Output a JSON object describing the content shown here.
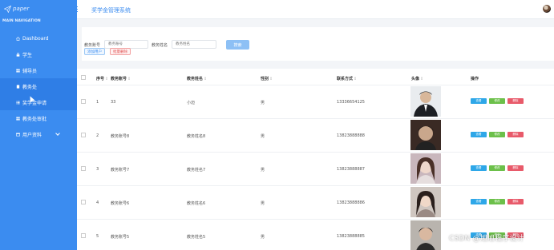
{
  "brand": {
    "logo_text": "paper"
  },
  "sidebar": {
    "caption": "MAIN NAVIGATION",
    "items": [
      {
        "label": "Dashboard",
        "icon": "home-icon"
      },
      {
        "label": "学生",
        "icon": "lock-icon"
      },
      {
        "label": "辅导员",
        "icon": "grid-icon"
      },
      {
        "label": "教务处",
        "icon": "doc-icon"
      },
      {
        "label": "奖学金申请",
        "icon": "list-icon"
      },
      {
        "label": "教务处审批",
        "icon": "grid-icon"
      },
      {
        "label": "用户资料",
        "icon": "card-icon"
      }
    ]
  },
  "header": {
    "title": "奖学金管理系统",
    "menu_icon": "hamburger-icon"
  },
  "search": {
    "label_account": "教务账号",
    "placeholder_account": "教务账号",
    "label_name": "教务姓名",
    "placeholder_name": "教务姓名",
    "search_label": "搜索",
    "add_label": "添加用户",
    "batch_delete_label": "批量删除"
  },
  "table": {
    "headers": [
      "序号",
      "教务账号",
      "教务姓名",
      "性别",
      "联系方式",
      "头像",
      "操作"
    ],
    "rows": [
      {
        "index": "1",
        "account": "33",
        "name": "小迈",
        "gender": "男",
        "phone": "13336654125"
      },
      {
        "index": "2",
        "account": "教务账号8",
        "name": "教务姓名8",
        "gender": "男",
        "phone": "13823888888"
      },
      {
        "index": "3",
        "account": "教务账号7",
        "name": "教务姓名7",
        "gender": "男",
        "phone": "13823888887"
      },
      {
        "index": "4",
        "account": "教务账号6",
        "name": "教务姓名6",
        "gender": "男",
        "phone": "13823888886"
      },
      {
        "index": "5",
        "account": "教务账号5",
        "name": "教务姓名5",
        "gender": "男",
        "phone": "13823888885"
      }
    ],
    "actions": {
      "detail": "查看",
      "edit": "修改",
      "delete": "删除"
    }
  },
  "watermark": "CSDN @旭旭程序设计",
  "colors": {
    "sidebar": "#3b8cf0",
    "detail": "#2ea7e8",
    "edit": "#6cc04a",
    "delete": "#e85a6a"
  }
}
